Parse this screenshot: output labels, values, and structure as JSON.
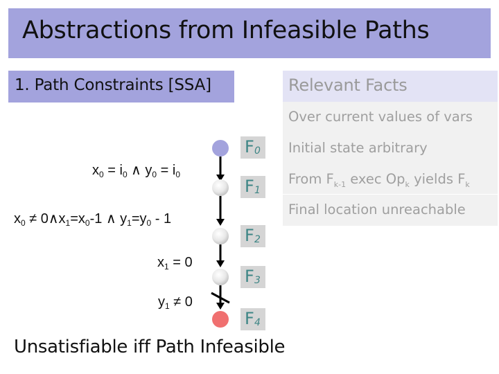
{
  "title": "Abstractions from Infeasible Paths",
  "section": "1. Path Constraints [SSA]",
  "facts": {
    "header": "Relevant Facts",
    "subheader": "Over current values of vars",
    "items": [
      {
        "text": "Initial state arbitrary"
      },
      {
        "pre": "From F",
        "sub1": "k-1",
        "mid": " exec Op",
        "sub2": "k",
        "mid2": " yields F",
        "sub3": "k"
      },
      {
        "text": "Final location unreachable"
      }
    ]
  },
  "nodes": [
    {
      "label": "F",
      "sub": "0",
      "color": "#a3a3dd"
    },
    {
      "label": "F",
      "sub": "1",
      "color": "#e6e6e6"
    },
    {
      "label": "F",
      "sub": "2",
      "color": "#e6e6e6"
    },
    {
      "label": "F",
      "sub": "3",
      "color": "#e6e6e6"
    },
    {
      "label": "F",
      "sub": "4",
      "color": "#f07070"
    }
  ],
  "constraints": {
    "c1": {
      "a": "x",
      "a_sub": "0",
      "b": " = i",
      "b_sub": "0",
      "c": " ∧ y",
      "c_sub": "0",
      "d": " = i",
      "d_sub": "0"
    },
    "c2": {
      "a": "x",
      "a_sub": "0",
      "b": " ≠ 0∧x",
      "b_sub": "1",
      "c": "=x",
      "c_sub": "0",
      "d": "-1 ∧ y",
      "d_sub": "1",
      "e": "=y",
      "e_sub": "0",
      "f": " - 1"
    },
    "c3": {
      "a": "x",
      "a_sub": "1",
      "b": " = 0"
    },
    "c4": {
      "a": "y",
      "a_sub": "1",
      "b": " ≠ 0"
    }
  },
  "conclusion": "Unsatisfiable iff Path Infeasible"
}
